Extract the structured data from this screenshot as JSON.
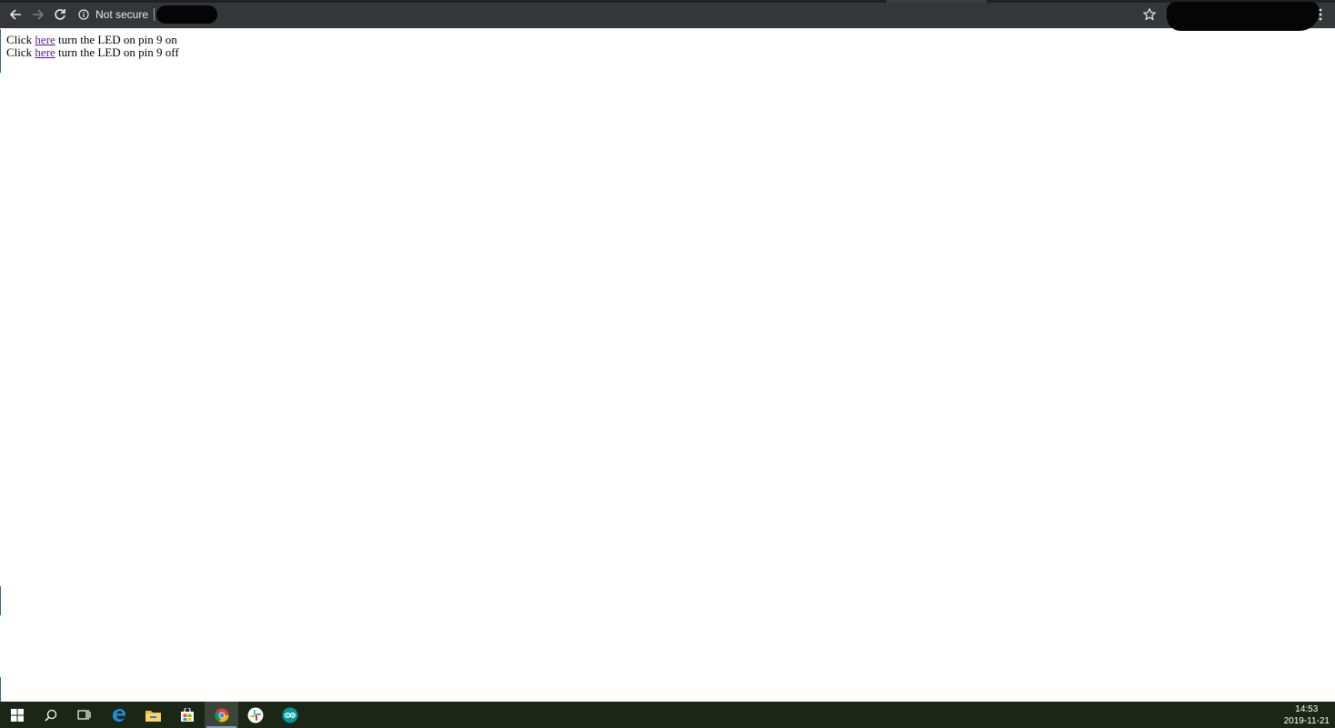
{
  "browser": {
    "security_label": "Not secure"
  },
  "page": {
    "lines": [
      {
        "prefix": "Click ",
        "link": "here",
        "suffix": " turn the LED on pin 9 on"
      },
      {
        "prefix": "Click ",
        "link": "here",
        "suffix": " turn the LED on pin 9 off"
      }
    ]
  },
  "taskbar": {
    "time": "14:53",
    "date": "2019-11-21",
    "apps": [
      "start-icon",
      "search-icon",
      "task-view-icon",
      "edge-icon",
      "file-explorer-icon",
      "store-icon",
      "chrome-icon",
      "slack-icon",
      "arduino-icon"
    ]
  },
  "colors": {
    "toolbar": "#35363a",
    "taskbar": "#1b2616",
    "visited_link": "#551a8b"
  }
}
